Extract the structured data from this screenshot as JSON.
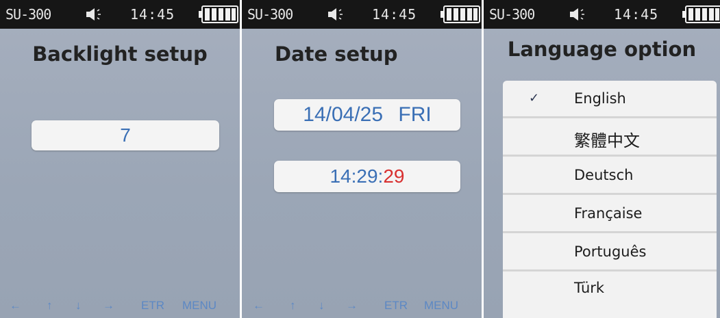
{
  "statusbar": {
    "model": "SU-300",
    "time": "14:45",
    "speaker_icon": "speaker-icon",
    "battery_icon": "battery-full-icon"
  },
  "screens": [
    {
      "title": "Backlight setup",
      "value": "7",
      "softkeys": [
        "←",
        "↑",
        "↓",
        "→",
        "ETR",
        "MENU"
      ]
    },
    {
      "title": "Date setup",
      "date": "14/04/25",
      "weekday": "FRI",
      "time_hm": "14:29:",
      "time_sec": "29",
      "softkeys": [
        "←",
        "↑",
        "↓",
        "→",
        "ETR",
        "MENU"
      ]
    },
    {
      "title": "Language option",
      "selected_mark": "✓",
      "languages": [
        "English",
        "繁體中文",
        "Deutsch",
        "Française",
        "Português",
        "Türk"
      ]
    }
  ],
  "colors": {
    "screen_bg": "#9ba6b6",
    "statusbar_bg": "#161616",
    "value_text": "#3a6fb5",
    "seconds_text": "#d83030",
    "softkey_text": "#5c88c4"
  }
}
